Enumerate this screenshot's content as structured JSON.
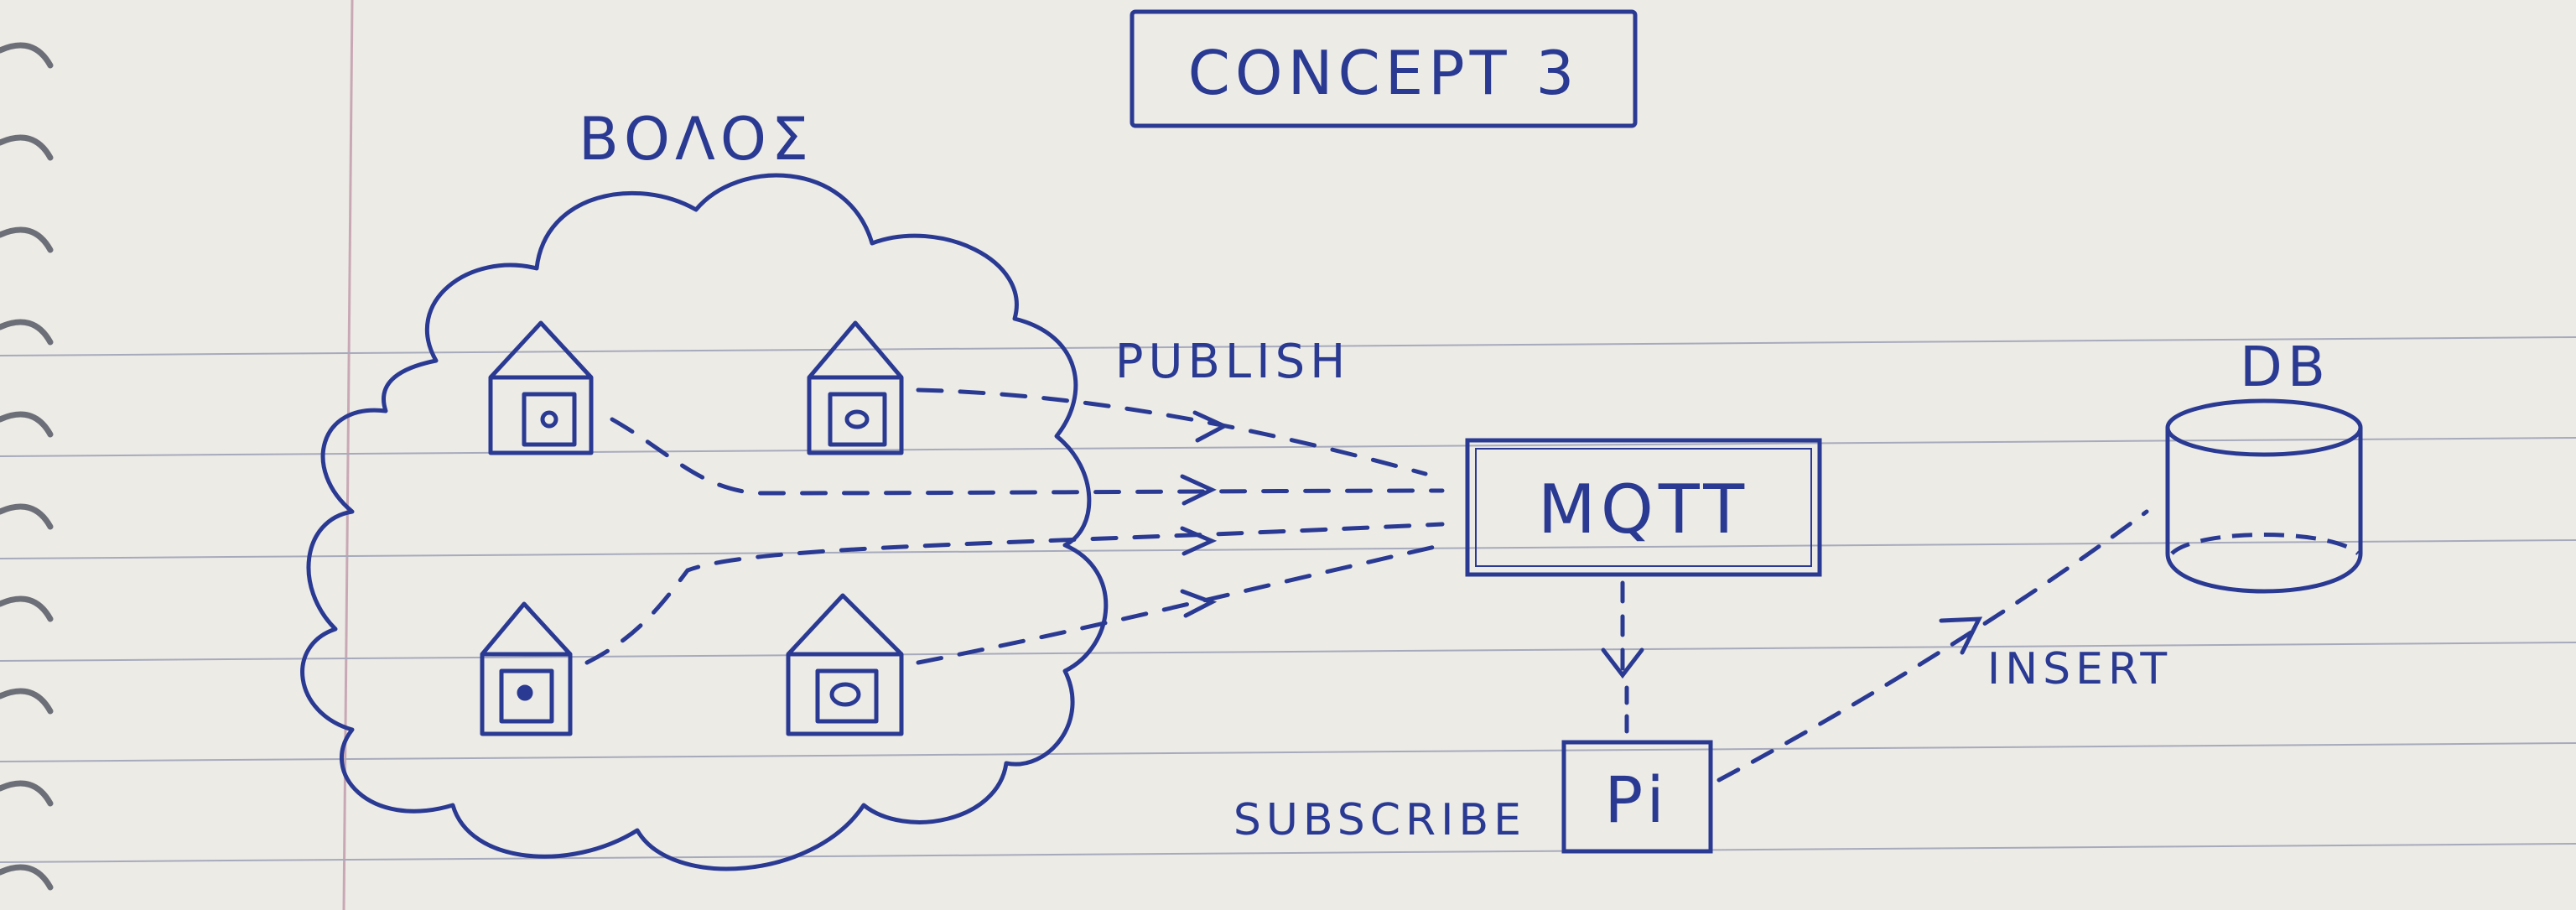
{
  "title": "CONCEPT 3",
  "region_label": "ΒΟΛΟΣ",
  "labels": {
    "publish": "PUBLISH",
    "subscribe": "SUBSCRIBE",
    "insert": "INSERT"
  },
  "nodes": {
    "broker": "MQTT",
    "subscriber": "Pi",
    "database": "DB"
  },
  "colors": {
    "ink": "#2a3a93",
    "paper": "#ecebe6",
    "rule": "#9fa3b7",
    "margin": "#c9a8b5"
  }
}
